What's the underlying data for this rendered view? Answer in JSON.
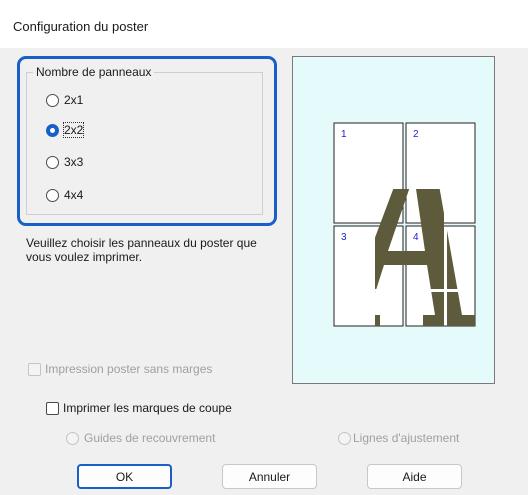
{
  "dialog": {
    "title": "Configuration du poster"
  },
  "panels": {
    "group_label": "Nombre de panneaux",
    "options": [
      {
        "label": "2x1",
        "checked": false
      },
      {
        "label": "2x2",
        "checked": true
      },
      {
        "label": "3x3",
        "checked": false
      },
      {
        "label": "4x4",
        "checked": false
      }
    ]
  },
  "hint": "Veuillez choisir les panneaux du poster que vous voulez imprimer.",
  "preview": {
    "panel_numbers": [
      "1",
      "2",
      "3",
      "4"
    ],
    "glyph": "A",
    "colors": {
      "background": "#e5fafa",
      "glyph": "#5e5a3c",
      "numbers": "#2222cc"
    }
  },
  "options": {
    "borderless": {
      "label": "Impression poster sans marges",
      "checked": false,
      "enabled": false
    },
    "cut_marks": {
      "label": "Imprimer les marques de coupe",
      "checked": false,
      "enabled": true
    },
    "overlap_guides": {
      "label": "Guides de recouvrement",
      "checked": false,
      "enabled": false
    },
    "trim_lines": {
      "label": "Lignes d'ajustement",
      "checked": false,
      "enabled": false
    }
  },
  "buttons": {
    "ok": "OK",
    "cancel": "Annuler",
    "help": "Aide"
  },
  "colors": {
    "accent": "#1a5fc8",
    "background": "#f0f0f0"
  }
}
